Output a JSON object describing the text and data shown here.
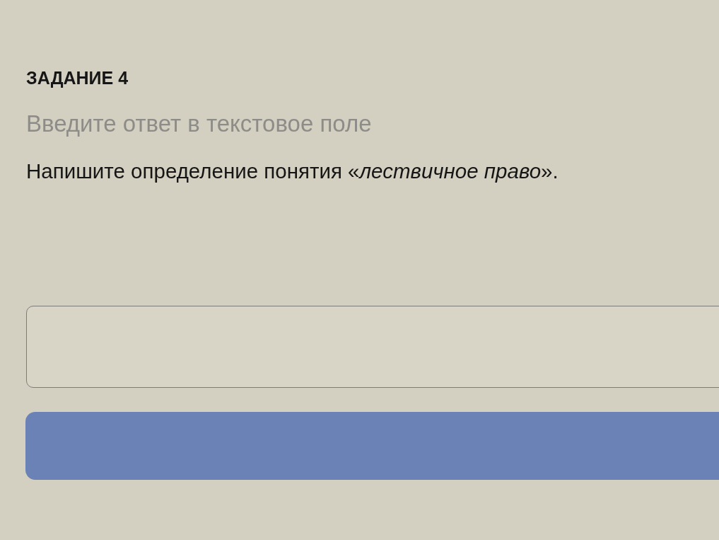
{
  "task": {
    "title": "ЗАДАНИЕ 4",
    "instruction": "Введите ответ в текстовое поле",
    "question": "Напишите определение понятия «*лествичное право*»."
  }
}
